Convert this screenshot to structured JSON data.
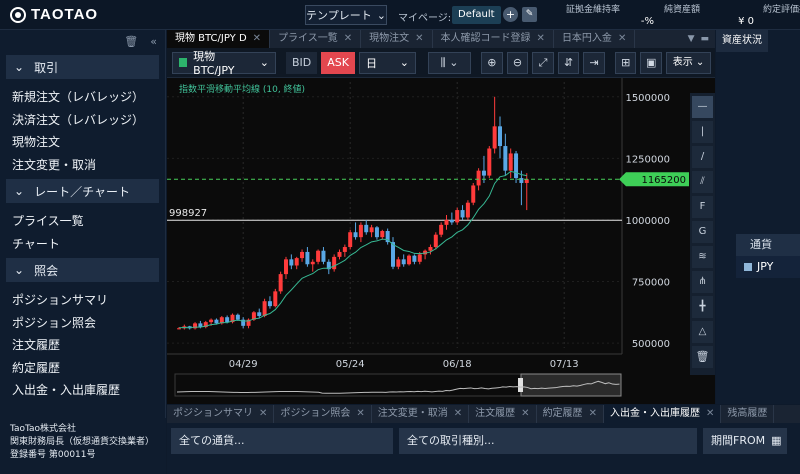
{
  "header": {
    "logo_text": "TAOTAO",
    "template_label": "テンプレート",
    "mypage_label": "マイページ:",
    "mypage_value": "Default",
    "stats": [
      {
        "label": "証拠金維持率",
        "value": "-%"
      },
      {
        "label": "純資産額",
        "value": "¥ 0"
      },
      {
        "label": "約定評価損益",
        "value": "¥ 0"
      }
    ]
  },
  "sidebar": {
    "sections": [
      {
        "title": "取引",
        "items": [
          "新規注文（レバレッジ）",
          "決済注文（レバレッジ）",
          "現物注文",
          "注文変更・取消"
        ]
      },
      {
        "title": "レート／チャート",
        "items": [
          "プライス一覧",
          "チャート"
        ]
      },
      {
        "title": "照会",
        "items": [
          "ポジションサマリ",
          "ポジション照会",
          "注文履歴",
          "約定履歴",
          "入出金・入出庫履歴"
        ]
      }
    ],
    "footer": [
      "TaoTao株式会社",
      "関東財務局長（仮想通貨交換業者）",
      "登録番号 第00011号"
    ]
  },
  "chart_tabs": [
    "現物 BTC/JPY D",
    "プライス一覧",
    "現物注文",
    "本人確認コード登録",
    "日本円入金"
  ],
  "toolbar": {
    "symbol": "現物 BTC/JPY",
    "bid": "BID",
    "ask": "ASK",
    "interval": "日",
    "display": "表示"
  },
  "chart_data": {
    "type": "candlestick",
    "indicator_label": "指数平滑移動平均線 (10, 終値)",
    "y_ticks": [
      500000,
      750000,
      1000000,
      1250000,
      1500000
    ],
    "y_tick_labels": [
      "500000",
      "750000",
      "1000000",
      "1250000",
      "1500000"
    ],
    "ylim": [
      480000,
      1560000
    ],
    "x_tick_labels": [
      "04/29",
      "05/24",
      "06/18",
      "07/13"
    ],
    "current_price": 1165200,
    "current_price_label": "1165200",
    "horizontal_line": 998927,
    "horizontal_line_label": "998927",
    "candles": [
      [
        560000,
        565000,
        555000,
        560000
      ],
      [
        560000,
        575000,
        555000,
        568000
      ],
      [
        568000,
        570000,
        555000,
        560000
      ],
      [
        560000,
        585000,
        555000,
        580000
      ],
      [
        580000,
        590000,
        560000,
        565000
      ],
      [
        565000,
        590000,
        560000,
        585000
      ],
      [
        585000,
        600000,
        570000,
        595000
      ],
      [
        595000,
        600000,
        575000,
        580000
      ],
      [
        580000,
        610000,
        575000,
        605000
      ],
      [
        605000,
        612000,
        580000,
        585000
      ],
      [
        585000,
        620000,
        580000,
        615000
      ],
      [
        615000,
        620000,
        590000,
        595000
      ],
      [
        595000,
        605000,
        560000,
        570000
      ],
      [
        570000,
        600000,
        560000,
        595000
      ],
      [
        595000,
        630000,
        590000,
        625000
      ],
      [
        625000,
        640000,
        600000,
        610000
      ],
      [
        610000,
        680000,
        605000,
        670000
      ],
      [
        670000,
        690000,
        640000,
        650000
      ],
      [
        650000,
        720000,
        645000,
        710000
      ],
      [
        710000,
        790000,
        700000,
        780000
      ],
      [
        780000,
        850000,
        760000,
        840000
      ],
      [
        840000,
        860000,
        800000,
        815000
      ],
      [
        815000,
        850000,
        800000,
        845000
      ],
      [
        845000,
        880000,
        830000,
        870000
      ],
      [
        870000,
        890000,
        810000,
        820000
      ],
      [
        820000,
        840000,
        790000,
        830000
      ],
      [
        830000,
        880000,
        820000,
        875000
      ],
      [
        875000,
        890000,
        820000,
        830000
      ],
      [
        830000,
        840000,
        780000,
        800000
      ],
      [
        800000,
        860000,
        790000,
        850000
      ],
      [
        850000,
        880000,
        840000,
        870000
      ],
      [
        870000,
        900000,
        850000,
        890000
      ],
      [
        890000,
        960000,
        880000,
        950000
      ],
      [
        950000,
        990000,
        920000,
        930000
      ],
      [
        930000,
        990000,
        910000,
        980000
      ],
      [
        980000,
        1000000,
        940000,
        950000
      ],
      [
        950000,
        980000,
        930000,
        970000
      ],
      [
        970000,
        975000,
        920000,
        930000
      ],
      [
        930000,
        960000,
        920000,
        955000
      ],
      [
        955000,
        965000,
        900000,
        910000
      ],
      [
        910000,
        930000,
        800000,
        810000
      ],
      [
        810000,
        850000,
        800000,
        840000
      ],
      [
        840000,
        860000,
        810000,
        820000
      ],
      [
        820000,
        860000,
        815000,
        855000
      ],
      [
        855000,
        860000,
        820000,
        830000
      ],
      [
        830000,
        870000,
        820000,
        860000
      ],
      [
        860000,
        880000,
        840000,
        875000
      ],
      [
        875000,
        900000,
        860000,
        890000
      ],
      [
        890000,
        950000,
        880000,
        940000
      ],
      [
        940000,
        990000,
        930000,
        980000
      ],
      [
        980000,
        1020000,
        960000,
        1000000
      ],
      [
        1000000,
        1030000,
        980000,
        990000
      ],
      [
        990000,
        1050000,
        980000,
        1040000
      ],
      [
        1040000,
        1060000,
        1000000,
        1010000
      ],
      [
        1010000,
        1080000,
        1000000,
        1070000
      ],
      [
        1070000,
        1150000,
        1060000,
        1140000
      ],
      [
        1140000,
        1210000,
        1120000,
        1200000
      ],
      [
        1200000,
        1260000,
        1150000,
        1180000
      ],
      [
        1180000,
        1300000,
        1170000,
        1290000
      ],
      [
        1290000,
        1500000,
        1270000,
        1380000
      ],
      [
        1380000,
        1420000,
        1250000,
        1300000
      ],
      [
        1300000,
        1350000,
        1180000,
        1200000
      ],
      [
        1200000,
        1290000,
        1170000,
        1270000
      ],
      [
        1270000,
        1280000,
        1150000,
        1170000
      ],
      [
        1170000,
        1200000,
        1060000,
        1150000
      ],
      [
        1150000,
        1190000,
        1040000,
        1165200
      ]
    ],
    "ema": [
      562000,
      563000,
      562000,
      565000,
      565000,
      569000,
      575000,
      577000,
      583000,
      583000,
      590000,
      593000,
      589000,
      590000,
      598000,
      601000,
      613000,
      620000,
      636000,
      662000,
      694000,
      716000,
      740000,
      763000,
      773000,
      782000,
      798000,
      804000,
      804000,
      813000,
      824000,
      836000,
      856000,
      869000,
      888000,
      899000,
      911000,
      915000,
      922000,
      920000,
      900000,
      889000,
      876000,
      872000,
      864000,
      863000,
      865000,
      870000,
      883000,
      901000,
      919000,
      931000,
      950000,
      960000,
      980000,
      1009000,
      1043000,
      1066000,
      1097000,
      1148000,
      1175000,
      1180000,
      1197000,
      1192000,
      1184000,
      1180000
    ]
  },
  "right_panel": {
    "tab": "資産状況",
    "header": "通貨",
    "row": "JPY"
  },
  "bottom": {
    "tabs": [
      "ポジションサマリ",
      "ポジション照会",
      "注文変更・取消",
      "注文履歴",
      "約定履歴",
      "入出金・入出庫履歴",
      "残高履歴"
    ],
    "active_tab": 5,
    "filters": [
      "全ての通貨...",
      "全ての取引種別...",
      "期間FROM"
    ]
  }
}
